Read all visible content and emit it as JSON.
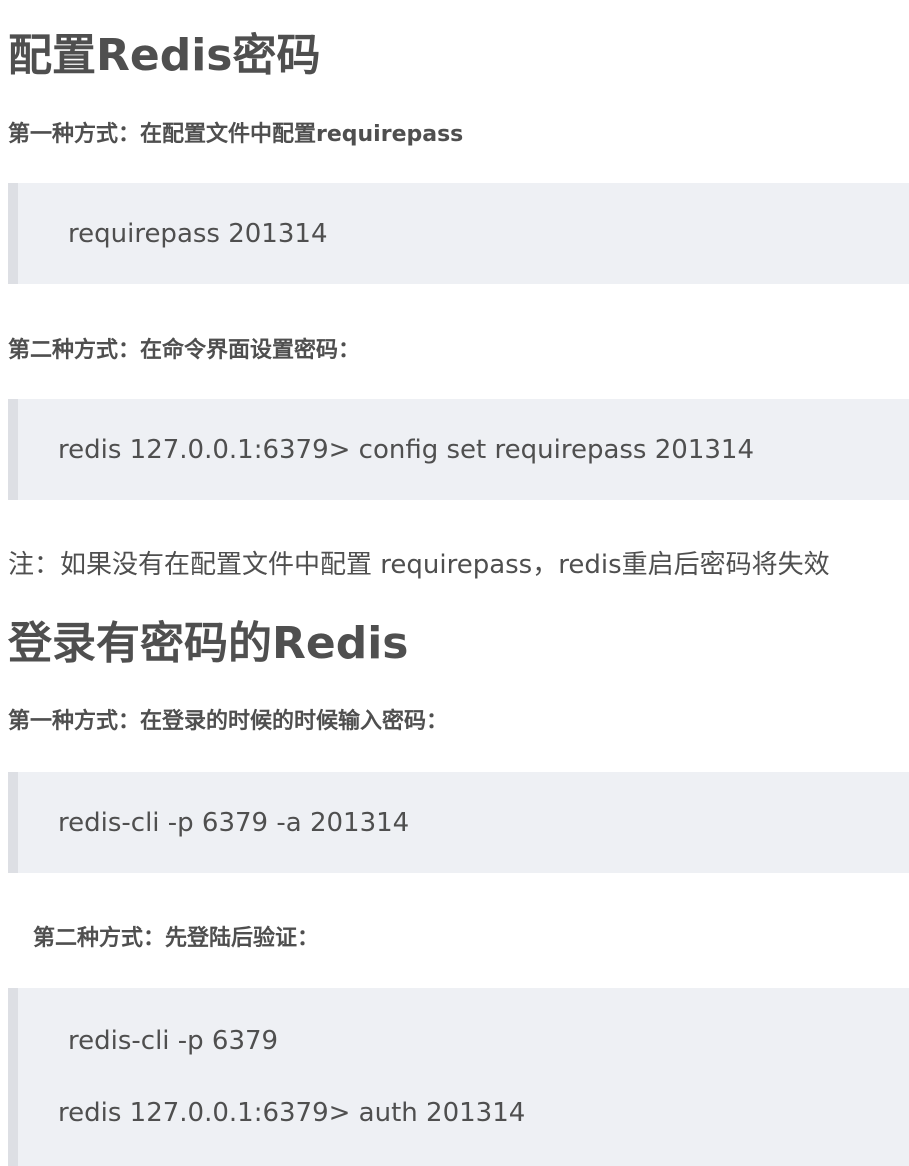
{
  "section1": {
    "title": "配置Redis密码",
    "method1_heading": "第一种方式：在配置文件中配置requirepass",
    "method1_code": "requirepass 201314",
    "method2_heading": "第二种方式：在命令界面设置密码：",
    "method2_code": "redis 127.0.0.1:6379> config set requirepass 201314",
    "note": "注：如果没有在配置文件中配置 requirepass，redis重启后密码将失效"
  },
  "section2": {
    "title": "登录有密码的Redis",
    "method1_heading": "第一种方式：在登录的时候的时候输入密码：",
    "method1_code": "redis-cli -p 6379 -a 201314",
    "method2_heading": "第二种方式：先登陆后验证：",
    "method2_code_lines": [
      "redis-cli -p 6379",
      "redis 127.0.0.1:6379> auth 201314"
    ]
  }
}
